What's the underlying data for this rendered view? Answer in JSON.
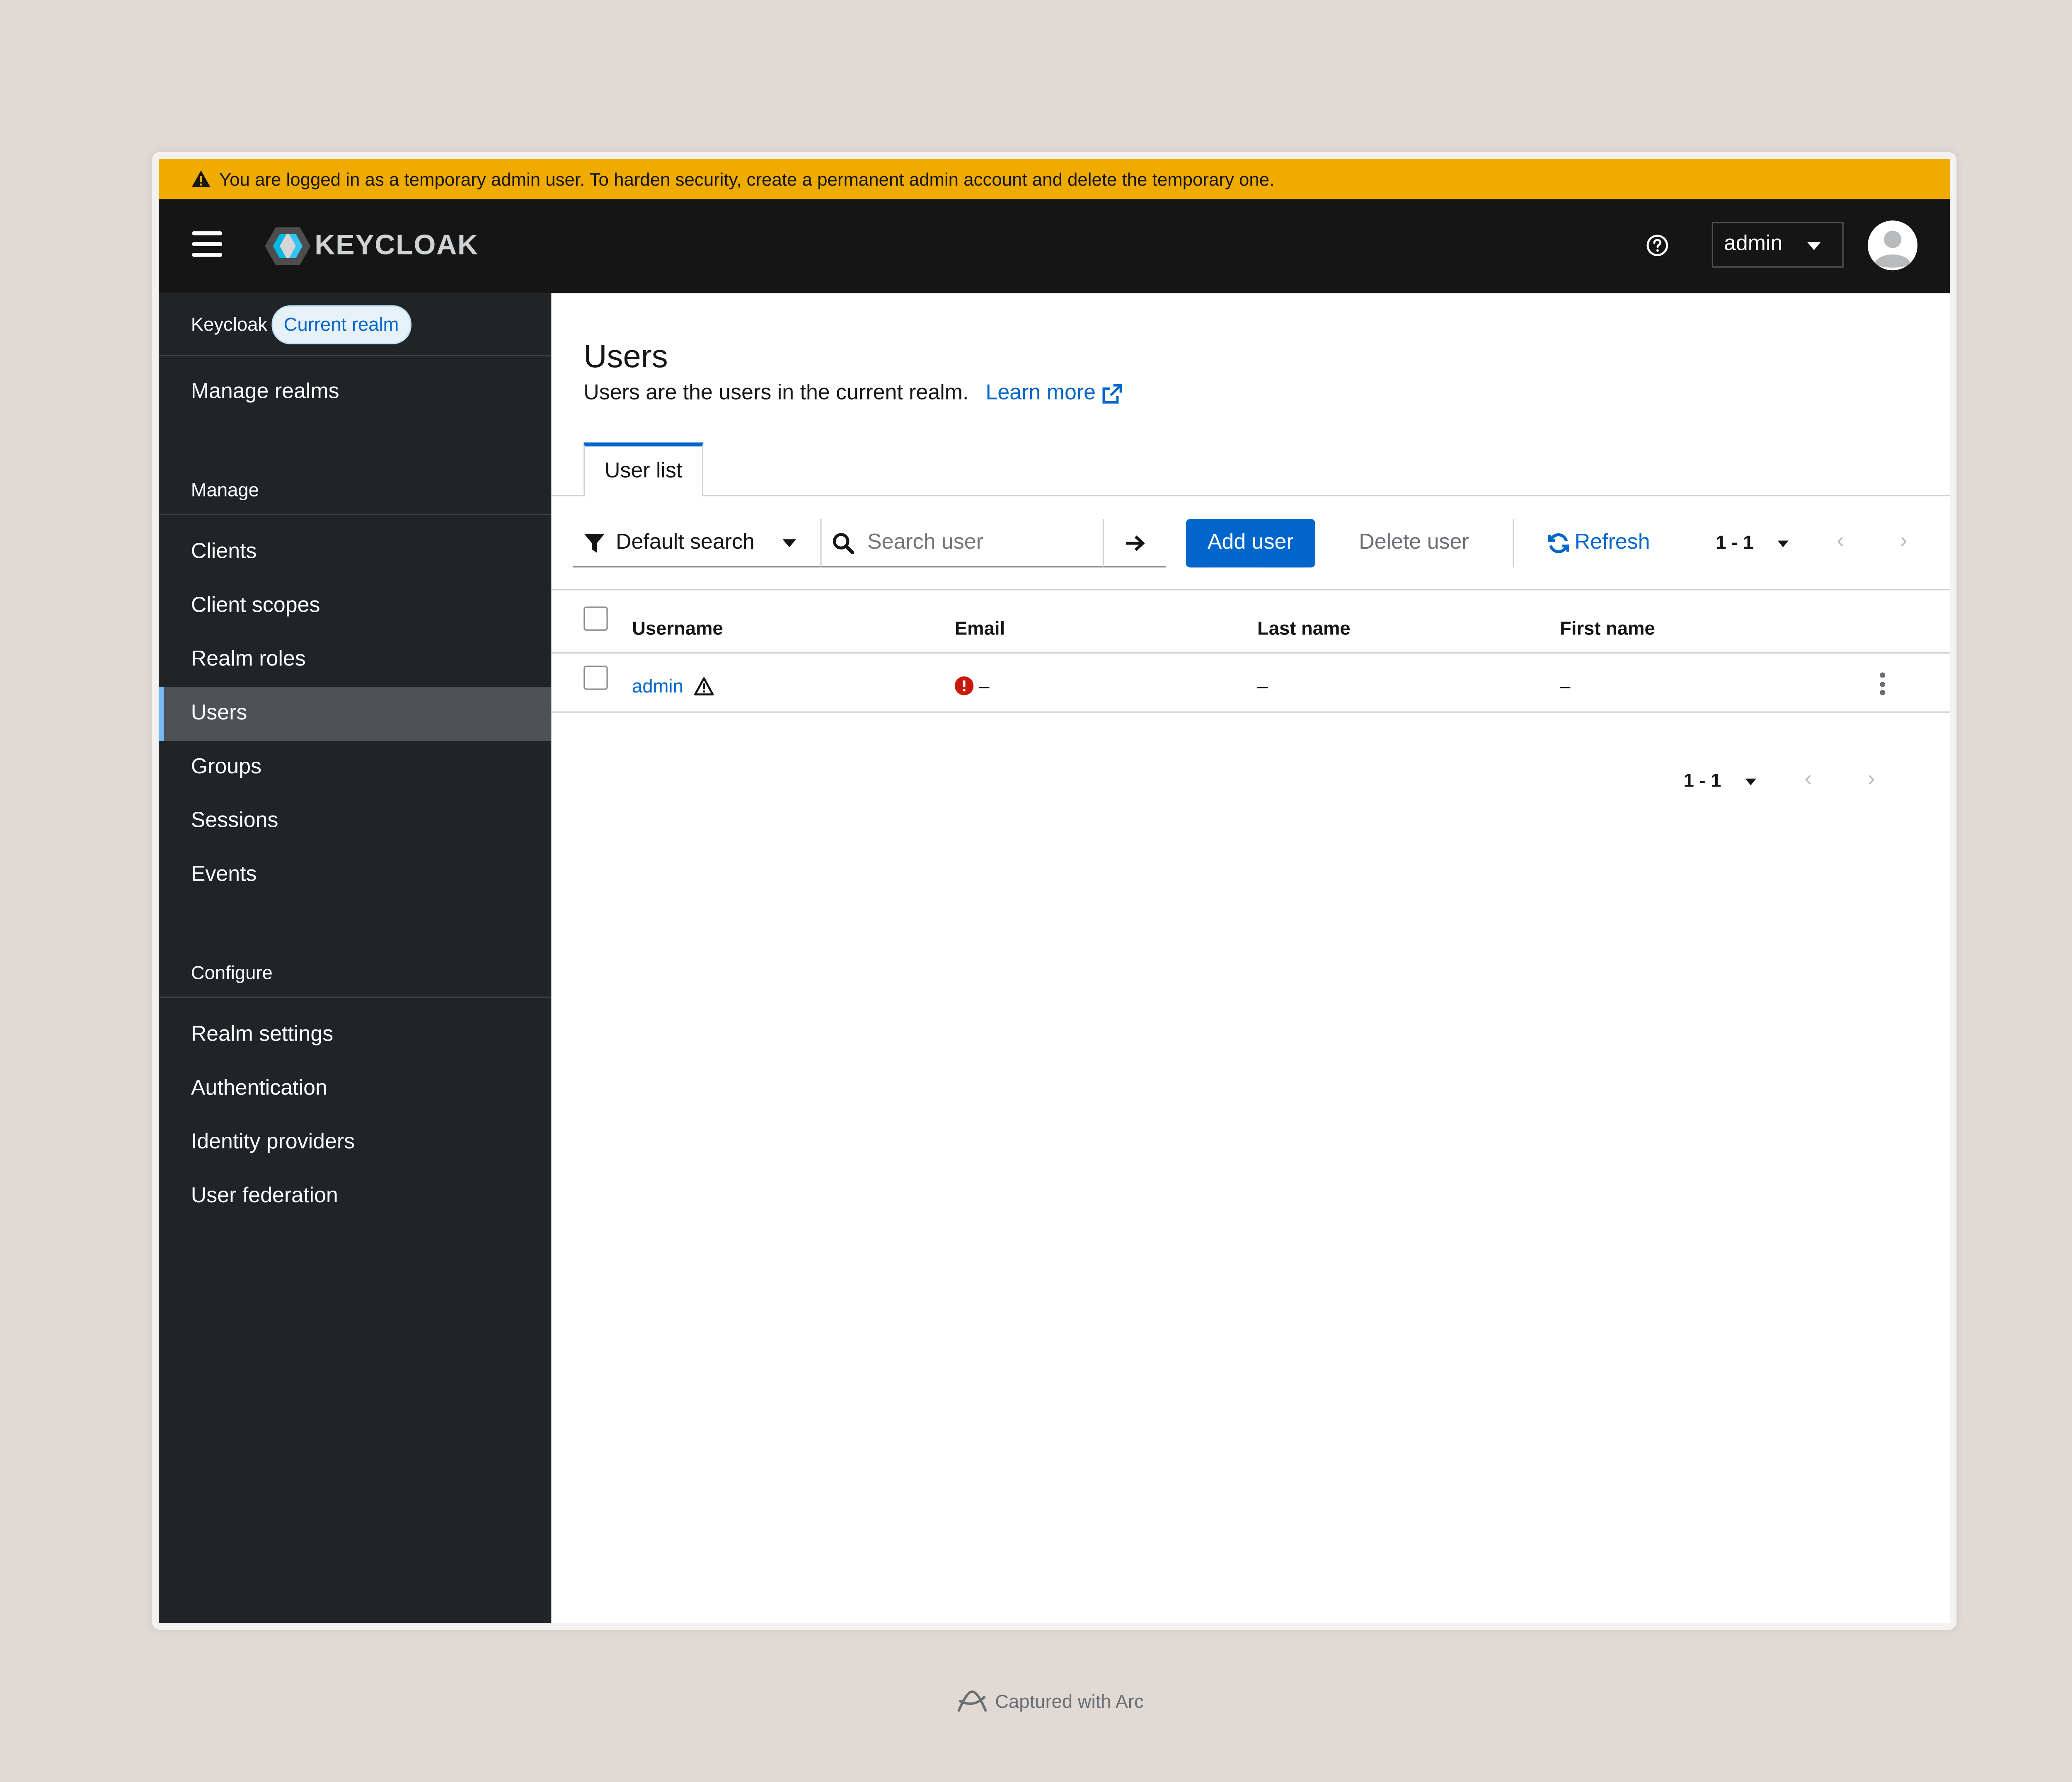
{
  "banner": {
    "text": "You are logged in as a temporary admin user. To harden security, create a permanent admin account and delete the temporary one."
  },
  "header": {
    "logo_text": "KEYCLOAK",
    "user_menu": "admin"
  },
  "sidebar": {
    "realm": {
      "name": "Keycloak",
      "badge": "Current realm"
    },
    "manage_realms": "Manage realms",
    "section_manage": "Manage",
    "manage_items": [
      {
        "label": "Clients"
      },
      {
        "label": "Client scopes"
      },
      {
        "label": "Realm roles"
      },
      {
        "label": "Users"
      },
      {
        "label": "Groups"
      },
      {
        "label": "Sessions"
      },
      {
        "label": "Events"
      }
    ],
    "section_configure": "Configure",
    "configure_items": [
      {
        "label": "Realm settings"
      },
      {
        "label": "Authentication"
      },
      {
        "label": "Identity providers"
      },
      {
        "label": "User federation"
      }
    ]
  },
  "page": {
    "title": "Users",
    "description": "Users are the users in the current realm.",
    "learn_more": "Learn more",
    "tab_user_list": "User list"
  },
  "toolbar": {
    "filter_label": "Default search",
    "search_placeholder": "Search user",
    "add_user": "Add user",
    "delete_user": "Delete user",
    "refresh": "Refresh",
    "pagination": "1 - 1"
  },
  "table": {
    "headers": {
      "username": "Username",
      "email": "Email",
      "last_name": "Last name",
      "first_name": "First name"
    },
    "rows": [
      {
        "username": "admin",
        "email": "–",
        "last_name": "–",
        "first_name": "–"
      }
    ]
  },
  "footer_pagination": "1 - 1",
  "captured": "Captured with Arc",
  "colors": {
    "banner": "#f0ab00",
    "topbar": "#151515",
    "sidebar": "#212427",
    "primary": "#0066cc",
    "active_nav": "#4f5255",
    "active_indicator": "#73bcf7"
  }
}
